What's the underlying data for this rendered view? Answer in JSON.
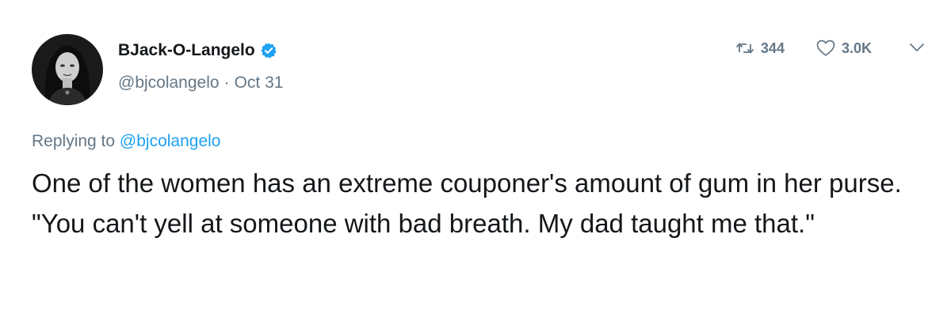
{
  "user": {
    "display_name": "BJack-O-Langelo",
    "handle": "@bjcolangelo",
    "separator": "·",
    "date": "Oct 31",
    "verified": true,
    "avatar_icon": "avatar-photo"
  },
  "actions": {
    "retweet_count": "344",
    "like_count": "3.0K",
    "retweet_icon": "retweet-icon",
    "like_icon": "heart-icon",
    "more_icon": "chevron-down-icon"
  },
  "reply": {
    "prefix": "Replying to",
    "mention": "@bjcolangelo"
  },
  "tweet": {
    "text": "One of the women has an extreme couponer's amount of gum in her purse. \"You can't yell at someone with bad breath. My dad taught me that.\""
  },
  "colors": {
    "accent": "#1da1f2",
    "secondary_text": "#657786",
    "primary_text": "#14171a"
  }
}
